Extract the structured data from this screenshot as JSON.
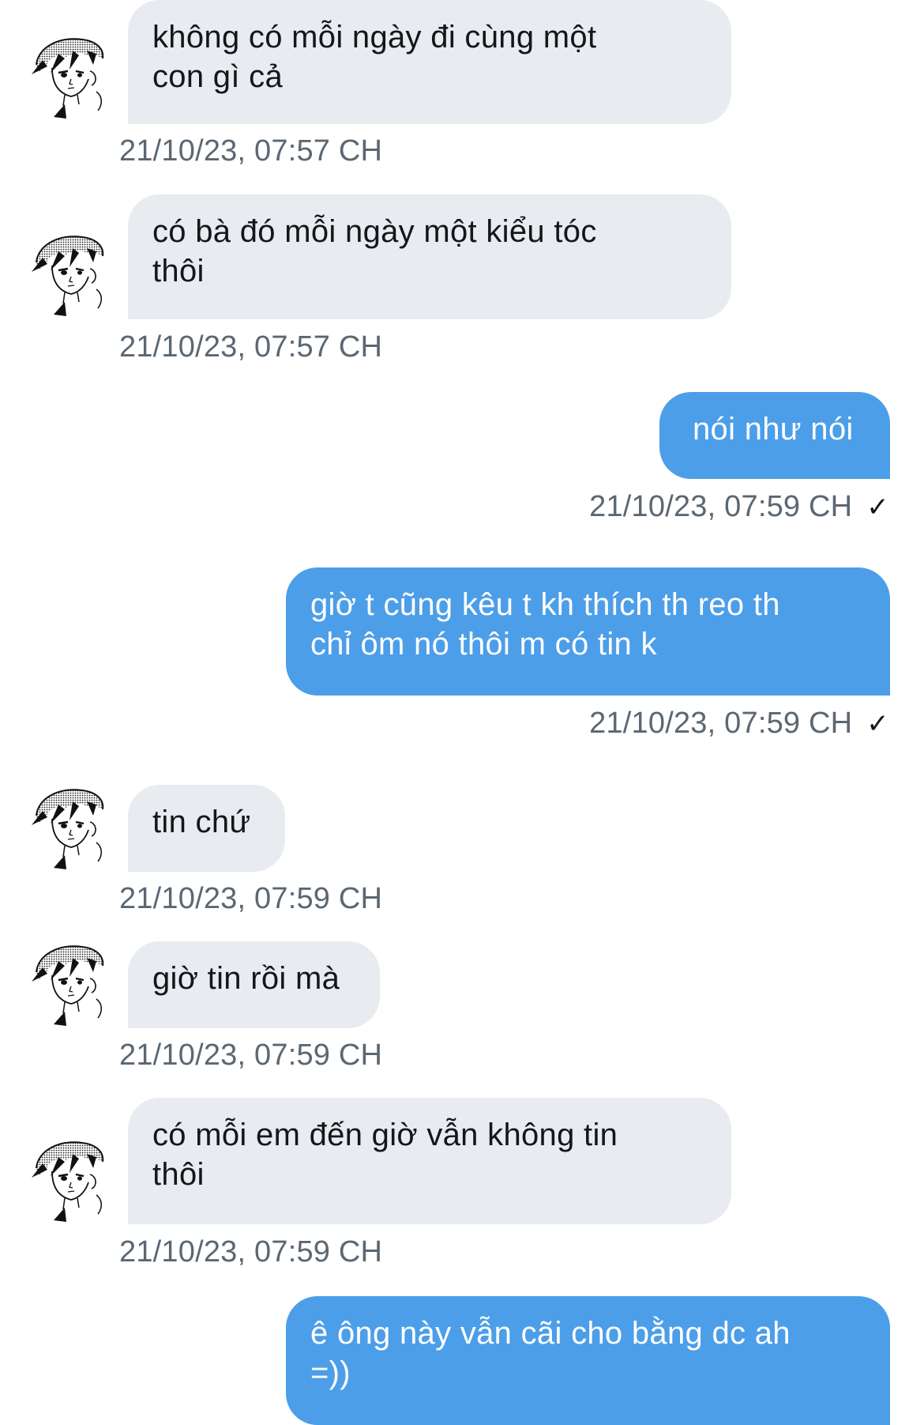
{
  "messages": [
    {
      "from": "them",
      "text_lines": [
        "không có mỗi ngày đi cùng một",
        "con gì cả"
      ],
      "time": "21/10/23, 07:57 CH"
    },
    {
      "from": "them",
      "text_lines": [
        "có bà đó mỗi ngày một kiểu tóc",
        "thôi"
      ],
      "time": "21/10/23, 07:57 CH"
    },
    {
      "from": "me",
      "text_lines": [
        "nói như nói"
      ],
      "time": "21/10/23, 07:59 CH",
      "status": "✓"
    },
    {
      "from": "me",
      "text_lines": [
        "giờ t cũng kêu t kh thích th reo th",
        "chỉ ôm nó thôi m có tin k"
      ],
      "time": "21/10/23, 07:59 CH",
      "status": "✓"
    },
    {
      "from": "them",
      "text_lines": [
        "tin chứ"
      ],
      "time": "21/10/23, 07:59 CH"
    },
    {
      "from": "them",
      "text_lines": [
        "giờ tin rồi mà"
      ],
      "time": "21/10/23, 07:59 CH"
    },
    {
      "from": "them",
      "text_lines": [
        "có mỗi em đến giờ vẫn không tin",
        "thôi"
      ],
      "time": "21/10/23, 07:59 CH"
    },
    {
      "from": "me",
      "text_lines": [
        " ê ông này vẫn cãi cho bằng dc ah",
        "=))"
      ],
      "time": ""
    }
  ],
  "colors": {
    "incoming_bubble": "#e8ebef",
    "outgoing_bubble": "#4c9ee8",
    "timestamp": "#5b6772"
  },
  "icons": {
    "avatar": "manga-avatar-icon",
    "read_receipt": "check-icon"
  }
}
